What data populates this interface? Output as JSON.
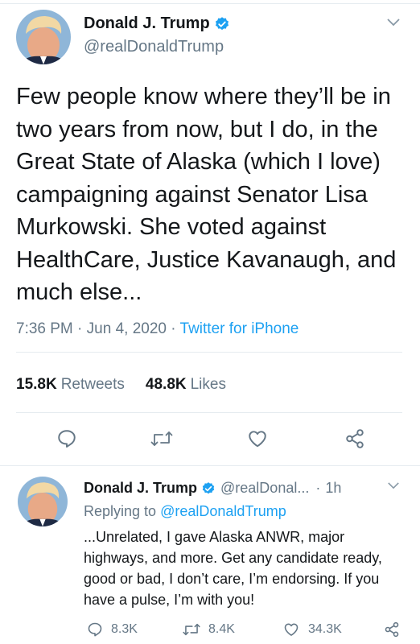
{
  "main_tweet": {
    "display_name": "Donald J. Trump",
    "handle": "@realDonaldTrump",
    "text": "Few people know where they’ll be in two years from now, but I do, in the Great State of Alaska (which I love) campaigning against Senator Lisa Murkowski. She voted against HealthCare, Justice Kavanaugh, and much else...",
    "time": "7:36 PM",
    "date": "Jun 4, 2020",
    "source": "Twitter for iPhone",
    "retweets_count": "15.8K",
    "retweets_label": "Retweets",
    "likes_count": "48.8K",
    "likes_label": "Likes"
  },
  "reply_tweet": {
    "display_name": "Donald J. Trump",
    "handle": "@realDonal...",
    "time": "1h",
    "replying_prefix": "Replying to",
    "replying_to": "@realDonaldTrump",
    "text": "...Unrelated, I gave Alaska ANWR, major highways, and more. Get any candidate ready, good or bad, I don’t care, I’m endorsing. If you have a pulse, I’m with you!",
    "replies": "8.3K",
    "retweets": "8.4K",
    "likes": "34.3K"
  },
  "separators": {
    "meta": "·"
  },
  "colors": {
    "accent": "#1da1f2",
    "secondary": "#657786",
    "text": "#14171a",
    "divider": "#e6ecf0",
    "verified": "#1da1f2"
  },
  "icons": [
    "verified-badge-icon",
    "chevron-down-icon",
    "reply-icon",
    "retweet-icon",
    "like-icon",
    "share-icon"
  ]
}
